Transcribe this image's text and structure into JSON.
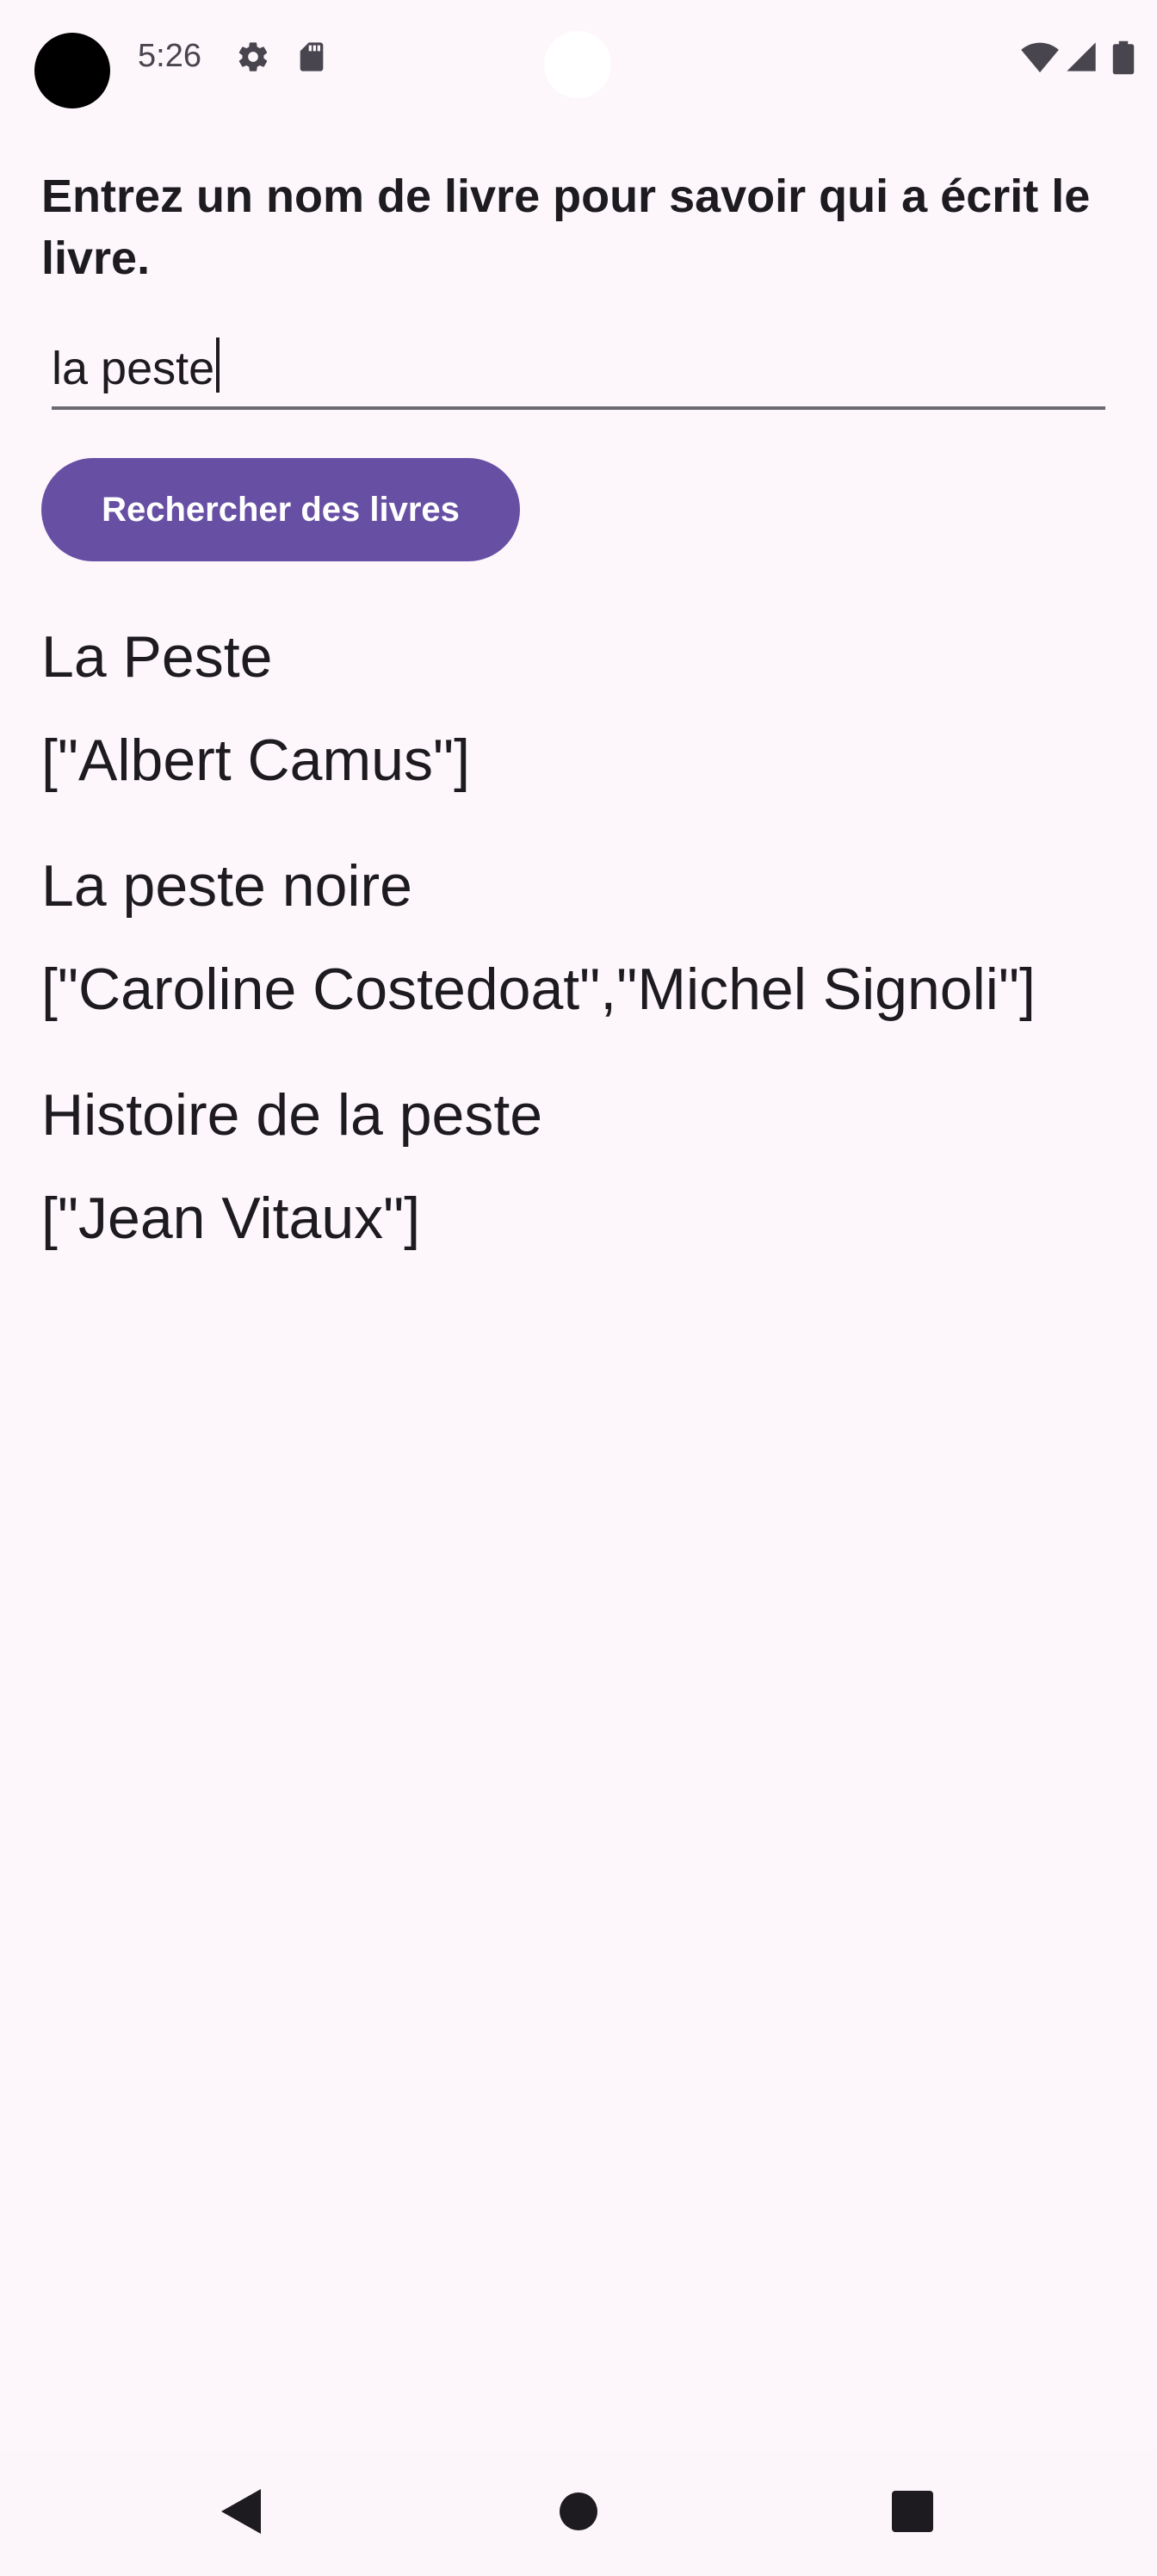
{
  "status_bar": {
    "time": "5:26",
    "icons": [
      "settings-gear-icon",
      "sd-card-icon",
      "wifi-icon",
      "cellular-signal-icon",
      "battery-icon"
    ]
  },
  "prompt": "Entrez un nom de livre pour savoir qui a écrit le livre.",
  "search": {
    "value": "la peste"
  },
  "search_button": {
    "label": "Rechercher des livres"
  },
  "results": [
    {
      "title": "La Peste",
      "authors": "[\"Albert Camus\"]"
    },
    {
      "title": "La peste noire",
      "authors": "[\"Caroline Costedoat\",\"Michel Signoli\"]"
    },
    {
      "title": "Histoire de la peste",
      "authors": "[\"Jean Vitaux\"]"
    }
  ],
  "navigation": {
    "buttons": [
      "back-icon",
      "home-icon",
      "recents-icon"
    ]
  },
  "colors": {
    "background": "#fdf7fc",
    "accent": "#6750a4",
    "text": "#1d1b20"
  }
}
